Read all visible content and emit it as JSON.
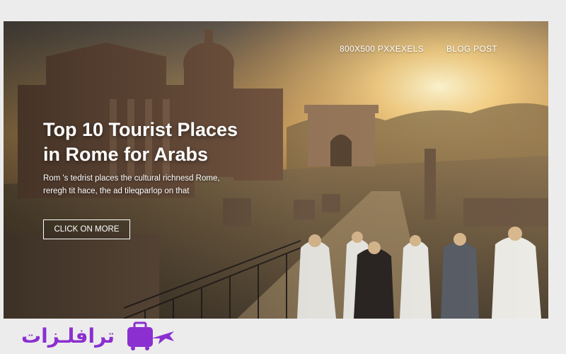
{
  "nav": {
    "items": [
      "800X500 PXXEXELS",
      "BLOG POST"
    ]
  },
  "hero": {
    "title_line1": "Top 10 Tourist Places",
    "title_line2": "in Rome for Arabs",
    "desc_line1": "Rom 's tedrist places the cultural richnesd Rome,",
    "desc_line2": "reregh tit hace, the ad tileqparlop on that",
    "cta_label": "CLICK ON MORE"
  },
  "brand": {
    "name": "ترافلـزات",
    "logo_icon": "suitcase-plane-icon",
    "color": "#8b2fd0"
  },
  "colors": {
    "sky_top": "#6a6158",
    "sun_glow": "#ffe7a8",
    "stone": "#8a6a4e",
    "accent": "#8b2fd0"
  }
}
